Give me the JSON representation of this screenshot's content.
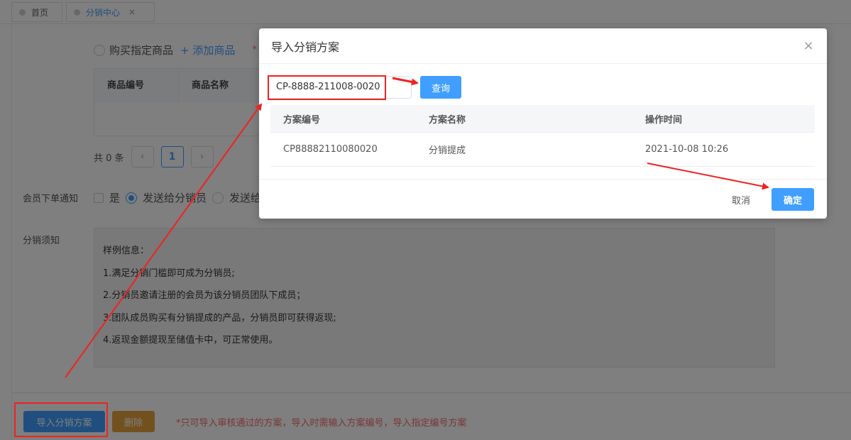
{
  "tabs": [
    {
      "label": "首页"
    },
    {
      "label": "分销中心",
      "close": "×"
    }
  ],
  "product_section": {
    "option_label": "购买指定商品",
    "add_link": "+ 添加商品",
    "required_mark": "*",
    "columns": [
      "商品编号",
      "商品名称"
    ]
  },
  "pager": {
    "total": "共 0 条",
    "prev": "‹",
    "current": "1",
    "next": "›"
  },
  "notify": {
    "label": "会员下单通知",
    "checkbox_label": "是",
    "option_1": "发送给分销员",
    "option_2": "发送给"
  },
  "description": {
    "label": "分销须知",
    "lines": [
      "样例信息：",
      "1.满足分销门槛即可成为分销员;",
      "2.分销员邀请注册的会员为该分销员团队下成员；",
      "3.团队成员购买有分销提成的产品，分销员即可获得返现;",
      "4.返现金额提现至储值卡中，可正常使用。"
    ]
  },
  "footer": {
    "import_button": "导入分销方案",
    "delete_button": "删除",
    "note": "*只可导入审核通过的方案，导入时需输入方案编号，导入指定编号方案"
  },
  "modal": {
    "title": "导入分销方案",
    "close": "×",
    "search_value": "CP-8888-211008-0020",
    "search_button": "查询",
    "columns": [
      "方案编号",
      "方案名称",
      "操作时间"
    ],
    "rows": [
      {
        "code": "CP88882110080020",
        "name": "分销提成",
        "time": "2021-10-08 10:26"
      }
    ],
    "cancel_button": "取消",
    "confirm_button": "确定"
  },
  "colors": {
    "primary": "#409eff",
    "warning": "#e6a23c",
    "danger": "#f56c6c",
    "annotation": "#ee2222"
  }
}
